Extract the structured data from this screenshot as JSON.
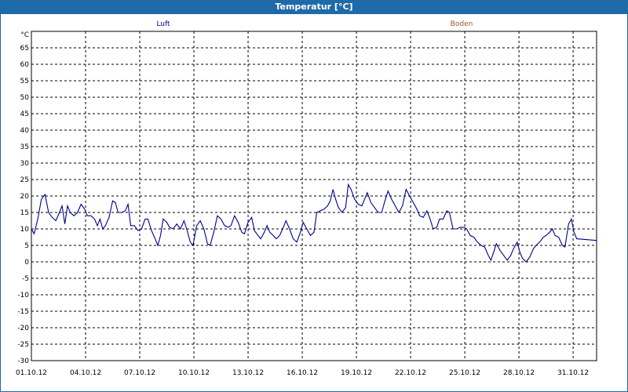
{
  "window": {
    "title": "Temperatur [°C]"
  },
  "chart_data": {
    "type": "line",
    "unit": "°C",
    "ylim": [
      -30,
      70
    ],
    "yticks": [
      -30,
      -25,
      -20,
      -15,
      -10,
      -5,
      0,
      5,
      10,
      15,
      20,
      25,
      30,
      35,
      40,
      45,
      50,
      55,
      60,
      65
    ],
    "xlabels": [
      "01.10.12",
      "04.10.12",
      "07.10.12",
      "10.10.12",
      "13.10.12",
      "16.10.12",
      "19.10.12",
      "22.10.12",
      "25.10.12",
      "28.10.12",
      "31.10.12"
    ],
    "xrange_days": [
      0,
      31.3
    ],
    "grid": true,
    "legend": [
      {
        "name": "Luft",
        "color": "#00008b"
      },
      {
        "name": "Boden",
        "color": "#a0522d"
      }
    ],
    "series": [
      {
        "name": "Luft",
        "color": "#00008b",
        "points": [
          [
            0.0,
            10
          ],
          [
            0.15,
            8.5
          ],
          [
            0.35,
            13
          ],
          [
            0.55,
            19
          ],
          [
            0.75,
            20.5
          ],
          [
            0.95,
            15
          ],
          [
            1.15,
            13.5
          ],
          [
            1.35,
            12.5
          ],
          [
            1.55,
            15
          ],
          [
            1.7,
            17
          ],
          [
            1.85,
            11.5
          ],
          [
            2.0,
            17
          ],
          [
            2.15,
            15
          ],
          [
            2.35,
            14
          ],
          [
            2.55,
            15
          ],
          [
            2.75,
            17.5
          ],
          [
            2.95,
            16
          ],
          [
            3.1,
            14
          ],
          [
            3.3,
            14
          ],
          [
            3.5,
            13
          ],
          [
            3.65,
            11
          ],
          [
            3.8,
            13
          ],
          [
            3.95,
            10
          ],
          [
            4.1,
            11
          ],
          [
            4.3,
            13.5
          ],
          [
            4.5,
            18.5
          ],
          [
            4.65,
            18
          ],
          [
            4.8,
            15
          ],
          [
            5.0,
            15
          ],
          [
            5.2,
            15.5
          ],
          [
            5.35,
            17.5
          ],
          [
            5.5,
            11
          ],
          [
            5.7,
            11
          ],
          [
            5.9,
            9.5
          ],
          [
            6.1,
            10
          ],
          [
            6.3,
            13
          ],
          [
            6.45,
            13
          ],
          [
            6.65,
            9.5
          ],
          [
            6.85,
            7
          ],
          [
            7.0,
            5
          ],
          [
            7.15,
            8
          ],
          [
            7.3,
            13
          ],
          [
            7.5,
            12
          ],
          [
            7.65,
            10.5
          ],
          [
            7.85,
            10
          ],
          [
            8.05,
            11.5
          ],
          [
            8.25,
            10
          ],
          [
            8.45,
            12.5
          ],
          [
            8.6,
            10
          ],
          [
            8.8,
            6
          ],
          [
            8.95,
            5
          ],
          [
            9.15,
            11
          ],
          [
            9.35,
            12.5
          ],
          [
            9.55,
            10
          ],
          [
            9.75,
            5.5
          ],
          [
            9.9,
            5
          ],
          [
            10.1,
            9
          ],
          [
            10.3,
            14
          ],
          [
            10.5,
            13
          ],
          [
            10.7,
            11
          ],
          [
            10.9,
            10.5
          ],
          [
            11.05,
            11
          ],
          [
            11.25,
            14
          ],
          [
            11.45,
            12
          ],
          [
            11.65,
            9
          ],
          [
            11.8,
            8.5
          ],
          [
            12.0,
            12
          ],
          [
            12.2,
            13.5
          ],
          [
            12.35,
            9.5
          ],
          [
            12.55,
            8
          ],
          [
            12.7,
            7
          ],
          [
            12.9,
            9
          ],
          [
            13.05,
            11
          ],
          [
            13.2,
            9
          ],
          [
            13.4,
            8
          ],
          [
            13.55,
            7
          ],
          [
            13.75,
            8
          ],
          [
            13.95,
            10.5
          ],
          [
            14.1,
            12.5
          ],
          [
            14.3,
            10
          ],
          [
            14.5,
            7
          ],
          [
            14.7,
            6
          ],
          [
            14.9,
            9
          ],
          [
            15.05,
            12
          ],
          [
            15.25,
            10
          ],
          [
            15.45,
            8
          ],
          [
            15.65,
            9
          ],
          [
            15.8,
            15
          ],
          [
            16.0,
            15.5
          ],
          [
            16.2,
            16
          ],
          [
            16.4,
            17
          ],
          [
            16.55,
            18.5
          ],
          [
            16.7,
            22
          ],
          [
            16.85,
            19
          ],
          [
            17.0,
            16.5
          ],
          [
            17.2,
            15
          ],
          [
            17.4,
            16.5
          ],
          [
            17.55,
            23.5
          ],
          [
            17.7,
            22
          ],
          [
            17.9,
            19
          ],
          [
            18.1,
            17.5
          ],
          [
            18.3,
            17
          ],
          [
            18.45,
            19
          ],
          [
            18.6,
            21
          ],
          [
            18.8,
            18
          ],
          [
            19.0,
            16.5
          ],
          [
            19.2,
            15
          ],
          [
            19.4,
            15
          ],
          [
            19.55,
            18
          ],
          [
            19.75,
            21.5
          ],
          [
            19.95,
            19
          ],
          [
            20.15,
            17
          ],
          [
            20.35,
            15
          ],
          [
            20.55,
            17
          ],
          [
            20.75,
            22
          ],
          [
            20.95,
            20
          ],
          [
            21.15,
            18
          ],
          [
            21.35,
            16
          ],
          [
            21.5,
            14
          ],
          [
            21.7,
            13.5
          ],
          [
            21.9,
            15.5
          ],
          [
            22.05,
            13.5
          ],
          [
            22.25,
            10
          ],
          [
            22.45,
            10.5
          ],
          [
            22.6,
            13
          ],
          [
            22.8,
            13
          ],
          [
            23.0,
            15.5
          ],
          [
            23.15,
            15
          ],
          [
            23.35,
            10
          ],
          [
            23.55,
            10
          ],
          [
            23.75,
            10.5
          ],
          [
            23.95,
            10.5
          ],
          [
            24.1,
            10
          ],
          [
            24.3,
            8
          ],
          [
            24.5,
            7.5
          ],
          [
            24.7,
            6
          ],
          [
            24.9,
            5
          ],
          [
            25.1,
            4.5
          ],
          [
            25.3,
            2
          ],
          [
            25.45,
            0.5
          ],
          [
            25.6,
            3
          ],
          [
            25.75,
            5.5
          ],
          [
            25.95,
            3.5
          ],
          [
            26.15,
            2
          ],
          [
            26.35,
            0.5
          ],
          [
            26.55,
            2
          ],
          [
            26.7,
            4
          ],
          [
            26.9,
            6
          ],
          [
            27.05,
            3
          ],
          [
            27.2,
            1
          ],
          [
            27.4,
            0
          ],
          [
            27.6,
            1.5
          ],
          [
            27.8,
            4
          ],
          [
            27.95,
            5
          ],
          [
            28.15,
            6
          ],
          [
            28.35,
            7.5
          ],
          [
            28.5,
            8
          ],
          [
            28.7,
            9
          ],
          [
            28.85,
            10
          ],
          [
            29.0,
            8
          ],
          [
            29.2,
            7.5
          ],
          [
            29.4,
            5
          ],
          [
            29.55,
            4.5
          ],
          [
            29.75,
            11.5
          ],
          [
            29.9,
            13
          ],
          [
            30.05,
            9
          ],
          [
            30.2,
            7
          ],
          [
            31.3,
            6.5
          ]
        ]
      }
    ]
  }
}
